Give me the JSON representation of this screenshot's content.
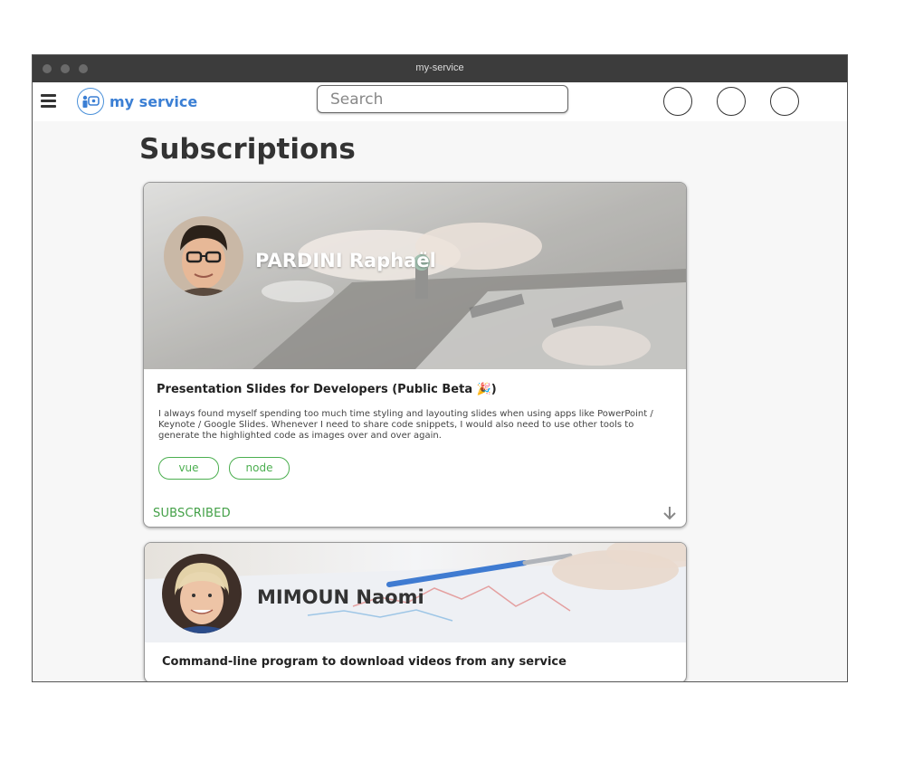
{
  "window": {
    "title": "my-service"
  },
  "navbar": {
    "logo_text": "my service",
    "search_placeholder": "Search"
  },
  "page": {
    "title": "Subscriptions"
  },
  "cards": [
    {
      "author": "PARDINI Raphaël",
      "title": "Presentation Slides for Developers (Public Beta 🎉)",
      "description": "I always found myself spending too much time styling and layouting slides when using apps like PowerPoint / Keynote / Google Slides. Whenever I need to share code snippets, I would also need to use other tools to generate the highlighted code as images over and over again.",
      "tags": [
        "vue",
        "node"
      ],
      "status": "SUBSCRIBED"
    },
    {
      "author": "MIMOUN Naomi",
      "title": "Command-line program to download videos from any service"
    }
  ],
  "colors": {
    "accent_blue": "#3b7fd4",
    "subscribed_green": "#43a047",
    "titlebar": "#3c3c3c"
  }
}
